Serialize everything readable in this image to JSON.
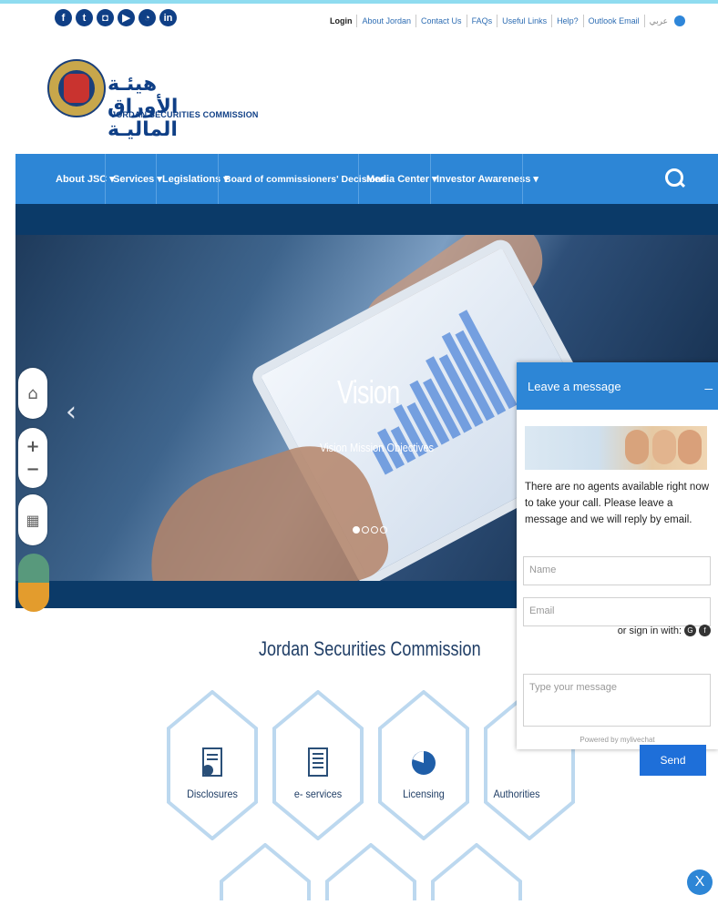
{
  "social_icons": [
    {
      "name": "facebook-icon",
      "glyph": "f"
    },
    {
      "name": "twitter-icon",
      "glyph": "t"
    },
    {
      "name": "instagram-icon",
      "glyph": "◘"
    },
    {
      "name": "youtube-icon",
      "glyph": "▶"
    },
    {
      "name": "rss-icon",
      "glyph": "◔"
    },
    {
      "name": "linkedin-icon",
      "glyph": "in"
    }
  ],
  "top_links": [
    "Login",
    "About Jordan",
    "Contact Us",
    "FAQs",
    "Useful Links",
    "Help?",
    "Outlook Email",
    "عربي"
  ],
  "org": {
    "name_ar": "هيئـة الأوراق الماليـة",
    "name_en": "JORDAN SECURITIES COMMISSION"
  },
  "nav": {
    "items": [
      "About JSC ▾",
      "Services ▾",
      "Legislations ▾",
      "Board of commissioners' Decisions",
      "Media Center ▾",
      "Investor Awareness ▾"
    ]
  },
  "hero": {
    "title": "Vision",
    "subtitle": "Vision Mission Objectives",
    "slide_count": 4,
    "active_slide": 1
  },
  "section": {
    "title": "Jordan Securities Commission",
    "tiles": [
      "Disclosures",
      "e- services",
      "Licensing",
      "Authorities"
    ]
  },
  "chat": {
    "header": "Leave a message",
    "minimize": "_",
    "message": "There are no agents available right now to take your call. Please leave a message and we will reply by email.",
    "name_placeholder": "Name",
    "email_placeholder": "Email",
    "signin_text": "or sign in with:",
    "message_placeholder": "Type your message",
    "send_label": "Send",
    "powered_by": "Powered by mylivechat",
    "close_label": "X"
  },
  "colors": {
    "nav_blue": "#2d86d6",
    "dark_navy": "#0b3a68",
    "brand_navy": "#0f3f86"
  }
}
